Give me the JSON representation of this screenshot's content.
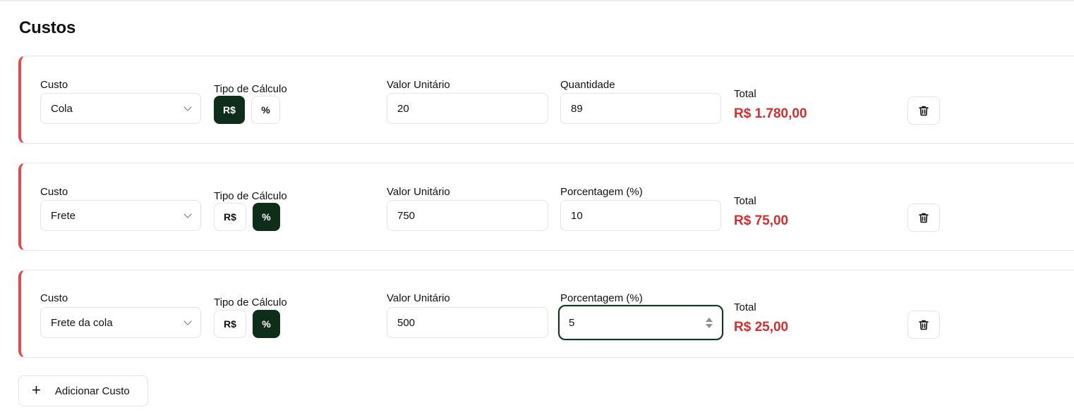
{
  "page": {
    "title": "Custos"
  },
  "labels": {
    "custo": "Custo",
    "tipo_calculo": "Tipo de Cálculo",
    "valor_unitario": "Valor Unitário",
    "total": "Total"
  },
  "toggle_options": {
    "currency": "R$",
    "percent": "%"
  },
  "costs": [
    {
      "custo": "Cola",
      "tipo_calculo_selected": "R$",
      "valor_unitario": "20",
      "qty_label": "Quantidade",
      "qty_value": "89",
      "total": "R$ 1.780,00"
    },
    {
      "custo": "Frete",
      "tipo_calculo_selected": "%",
      "valor_unitario": "750",
      "qty_label": "Porcentagem (%)",
      "qty_value": "10",
      "total": "R$ 75,00"
    },
    {
      "custo": "Frete da cola",
      "tipo_calculo_selected": "%",
      "valor_unitario": "500",
      "qty_label": "Porcentagem (%)",
      "qty_value": "5",
      "total": "R$ 25,00"
    }
  ],
  "add_button": {
    "label": "Adicionar Custo",
    "icon": "plus-icon"
  },
  "colors": {
    "accent_dark_green": "#0f2e1a",
    "total_red": "#d92d2d",
    "card_left_border": "#e5484d"
  }
}
